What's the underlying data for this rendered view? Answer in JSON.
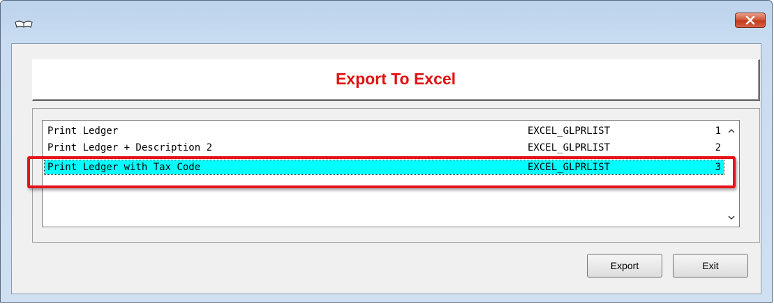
{
  "window": {
    "icon": "book-icon",
    "close_icon": "close-icon"
  },
  "header": {
    "title": "Export To Excel",
    "title_color": "#e01010"
  },
  "list": {
    "items": [
      {
        "name": "Print Ledger",
        "code": "EXCEL_GLPRLIST",
        "num": "1"
      },
      {
        "name": "Print Ledger + Description 2",
        "code": "EXCEL_GLPRLIST",
        "num": "2"
      },
      {
        "name": "Print Ledger with Tax Code",
        "code": "EXCEL_GLPRLIST",
        "num": "3"
      }
    ],
    "selected_index": 2,
    "selected_color": "#00ffff"
  },
  "buttons": {
    "export_label": "Export",
    "exit_label": "Exit"
  },
  "annotation": {
    "highlight_color": "#e4141c"
  }
}
